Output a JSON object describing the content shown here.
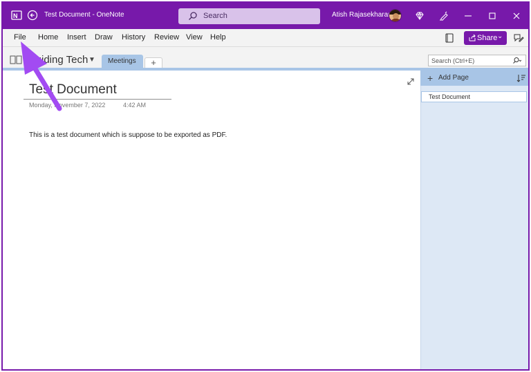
{
  "titlebar": {
    "title": "Test Document  -  OneNote",
    "search_placeholder": "Search",
    "user_name": "Atish Rajasekharan"
  },
  "menu": {
    "items": [
      "File",
      "Home",
      "Insert",
      "Draw",
      "History",
      "Review",
      "View",
      "Help"
    ],
    "share_label": "Share"
  },
  "notebook": {
    "name": "Guiding Tech",
    "sections": [
      "Meetings"
    ],
    "add_section": "+",
    "search_placeholder": "Search (Ctrl+E)"
  },
  "page": {
    "title": "Test Document",
    "date": "Monday, November 7, 2022",
    "time": "4:42 AM",
    "body": "This is a test document which is suppose to be exported as PDF."
  },
  "pagelist": {
    "add_page_label": "Add Page",
    "pages": [
      "Test Document"
    ]
  },
  "colors": {
    "accent": "#7719aa",
    "section_tab": "#a8c5e6",
    "pagelist_bg": "#dde8f5",
    "arrow": "#a24bf2"
  }
}
